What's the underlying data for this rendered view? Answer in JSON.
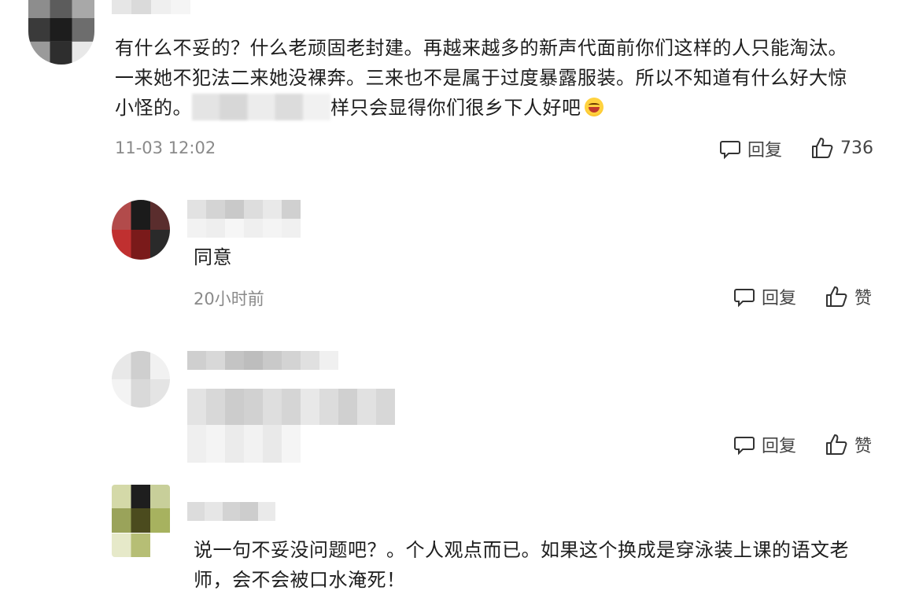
{
  "comments": [
    {
      "text_line1": "有什么不妥的？什么老顽固老封建。再越来越多的新声代面前你们这样的人只能淘汰。",
      "text_line2": "一来她不犯法二来她没裸奔。三来也不是属于过度暴露服装。所以不知道有什么好大惊",
      "text_line3_start": "小怪的。",
      "text_line3_end": "样只会显得你们很乡下人好吧",
      "emoji": "grinning-face-emoji",
      "time": "11-03 12:02",
      "reply_label": "回复",
      "like_count": "736"
    },
    {
      "text": "同意",
      "time": "20小时前",
      "reply_label": "回复",
      "like_label": "赞"
    },
    {
      "reply_label": "回复",
      "like_label": "赞"
    },
    {
      "text_line1": "说一句不妥没问题吧？。个人观点而已。如果这个换成是穿泳装上课的语文老",
      "text_line2": "师，会不会被口水淹死！"
    }
  ],
  "icons": {
    "reply": "comment-bubble-icon",
    "like": "thumbs-up-icon"
  }
}
